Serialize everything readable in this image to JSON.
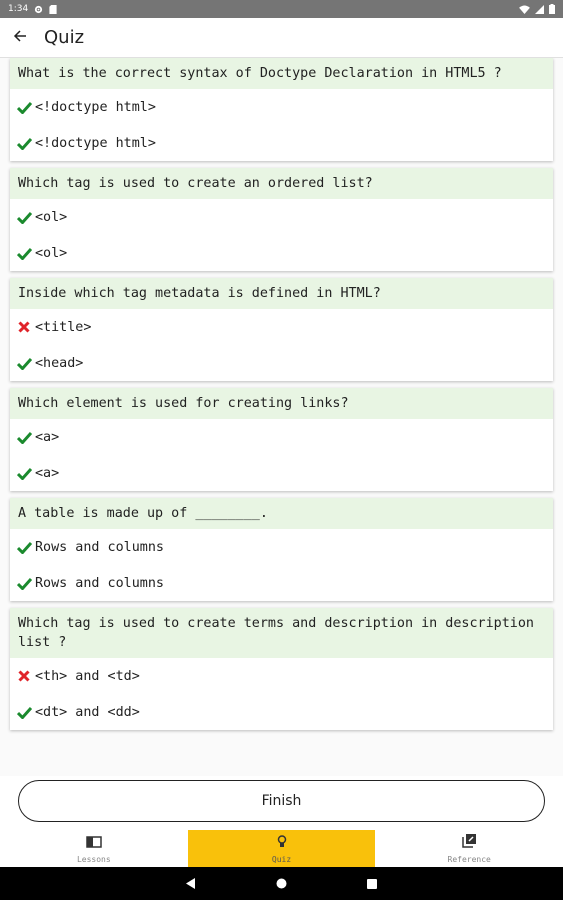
{
  "status_bar": {
    "time": "1:34"
  },
  "app_bar": {
    "title": "Quiz"
  },
  "questions": [
    {
      "text": "What is the correct syntax of Doctype Declaration in HTML5 ?",
      "answers": [
        {
          "mark": "correct",
          "text": "<!doctype html>"
        },
        {
          "mark": "correct",
          "text": "<!doctype html>"
        }
      ]
    },
    {
      "text": "Which tag is used to create an ordered list?",
      "answers": [
        {
          "mark": "correct",
          "text": "<ol>"
        },
        {
          "mark": "correct",
          "text": "<ol>"
        }
      ]
    },
    {
      "text": "Inside which tag metadata is defined in HTML?",
      "answers": [
        {
          "mark": "wrong",
          "text": "<title>"
        },
        {
          "mark": "correct",
          "text": "<head>"
        }
      ]
    },
    {
      "text": "Which element is used for creating links?",
      "answers": [
        {
          "mark": "correct",
          "text": "<a>"
        },
        {
          "mark": "correct",
          "text": "<a>"
        }
      ]
    },
    {
      "text": "A table is made up of ________.",
      "answers": [
        {
          "mark": "correct",
          "text": "Rows and columns"
        },
        {
          "mark": "correct",
          "text": "Rows and columns"
        }
      ]
    },
    {
      "text": "Which tag is used to create terms and description in description list ?",
      "answers": [
        {
          "mark": "wrong",
          "text": "<th> and <td>"
        },
        {
          "mark": "correct",
          "text": "<dt> and <dd>"
        }
      ]
    }
  ],
  "finish_label": "Finish",
  "bottom_nav": [
    {
      "label": "Lessons",
      "icon": "book-icon",
      "active": false
    },
    {
      "label": "Quiz",
      "icon": "bulb-icon",
      "active": true
    },
    {
      "label": "Reference",
      "icon": "reference-icon",
      "active": false
    }
  ],
  "colors": {
    "question_bg": "#e8f5e3",
    "correct": "#1b8a2e",
    "wrong": "#e0242a",
    "nav_active": "#f9c10b"
  }
}
